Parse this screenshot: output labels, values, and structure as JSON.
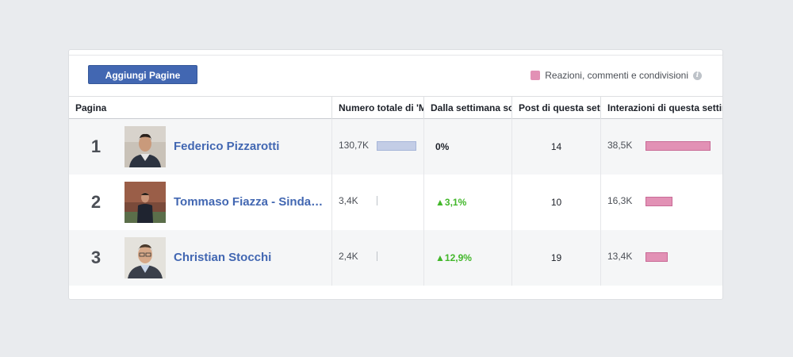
{
  "toolbar": {
    "add_pages_label": "Aggiungi Pagine"
  },
  "legend": {
    "label": "Reazioni, commenti e condivisioni",
    "color": "#e291b5",
    "info_icon": "i"
  },
  "columns": {
    "page": "Pagina",
    "total_fans": "Numero totale di 'Mi piace' della Pagina",
    "weekly_change": "Dalla settimana scorsa",
    "posts_week": "Post di questa settimana",
    "interactions_week": "Interazioni di questa settimana"
  },
  "rows": [
    {
      "rank": "1",
      "name": "Federico Pizzarotti",
      "total_fans": "130,7K",
      "fans_fraction": 1.0,
      "change": "0%",
      "change_dir": "flat",
      "posts": "14",
      "interactions": "38,5K",
      "interactions_fraction": 1.0
    },
    {
      "rank": "2",
      "name": "Tommaso Fiazza - Sindaco di Fidenza",
      "total_fans": "3,4K",
      "fans_fraction": 0.026,
      "change": "3,1%",
      "change_dir": "up",
      "posts": "10",
      "interactions": "16,3K",
      "interactions_fraction": 0.423
    },
    {
      "rank": "3",
      "name": "Christian Stocchi",
      "total_fans": "2,4K",
      "fans_fraction": 0.018,
      "change": "12,9%",
      "change_dir": "up",
      "posts": "19",
      "interactions": "13,4K",
      "interactions_fraction": 0.348
    }
  ],
  "colors": {
    "accent": "#4267b2",
    "positive": "#42b72a",
    "interactions_bar": "#e291b5",
    "fans_bar": "#c3cde6"
  }
}
